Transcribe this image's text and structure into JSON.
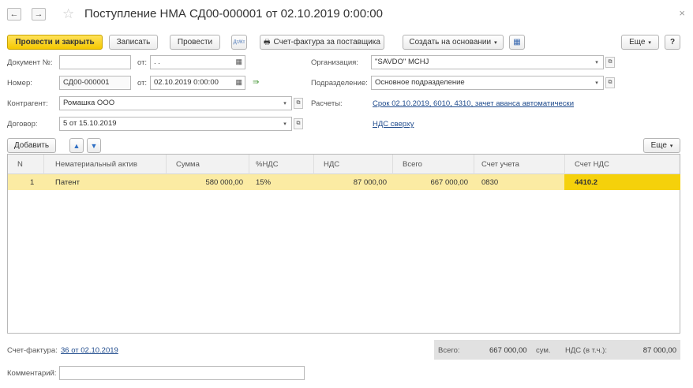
{
  "window": {
    "title": "Поступление НМА СД00-000001 от 02.10.2019 0:00:00",
    "back_icon": "←",
    "forward_icon": "→",
    "star_icon": "☆",
    "close_icon": "×"
  },
  "toolbar": {
    "post_close": "Провести и закрыть",
    "save": "Записать",
    "post": "Провести",
    "dt_kt_icon": "Дт/Кт",
    "invoice_supplier": "Счет-фактура за поставщика",
    "create_based_on": "Создать на основании",
    "more": "Еще",
    "help": "?"
  },
  "form": {
    "doc_no_label": "Документ №:",
    "doc_no_value": "",
    "ot_label": "от:",
    "doc_date_value": " .  .",
    "number_label": "Номер:",
    "number_value": "СД00-000001",
    "number_date_value": "02.10.2019  0:00:00",
    "counterparty_label": "Контрагент:",
    "counterparty_value": "Ромашка ООО",
    "contract_label": "Договор:",
    "contract_value": "5 от 15.10.2019",
    "org_label": "Организация:",
    "org_value": "\"SAVDO\" MCHJ",
    "dept_label": "Подразделение:",
    "dept_value": "Основное подразделение",
    "settlements_label": "Расчеты:",
    "settlements_link": "Срок 02.10.2019, 6010, 4310, зачет аванса автоматически",
    "vat_link": "НДС сверху"
  },
  "table_toolbar": {
    "add": "Добавить",
    "up_icon": "🡅",
    "down_icon": "🡇",
    "more": "Еще"
  },
  "table": {
    "columns": [
      "N",
      "Нематериальный актив",
      "Сумма",
      "%НДС",
      "НДС",
      "Всего",
      "Счет учета",
      "Счет НДС"
    ],
    "rows": [
      [
        "1",
        "Патент",
        "580 000,00",
        "15%",
        "87 000,00",
        "667 000,00",
        "0830",
        "4410.2"
      ]
    ]
  },
  "footer": {
    "invoice_label": "Счет-фактура:",
    "invoice_link": "36 от 02.10.2019",
    "total_label": "Всего:",
    "total_value": "667 000,00",
    "currency": "сум.",
    "vat_label": "НДС (в т.ч.):",
    "vat_value": "87 000,00",
    "comment_label": "Комментарий:",
    "comment_value": ""
  },
  "colors": {
    "primary_button": "#f5c800",
    "selected_row": "#fbeba3",
    "selected_cell": "#f5d10b",
    "link": "#1e4a8c"
  }
}
